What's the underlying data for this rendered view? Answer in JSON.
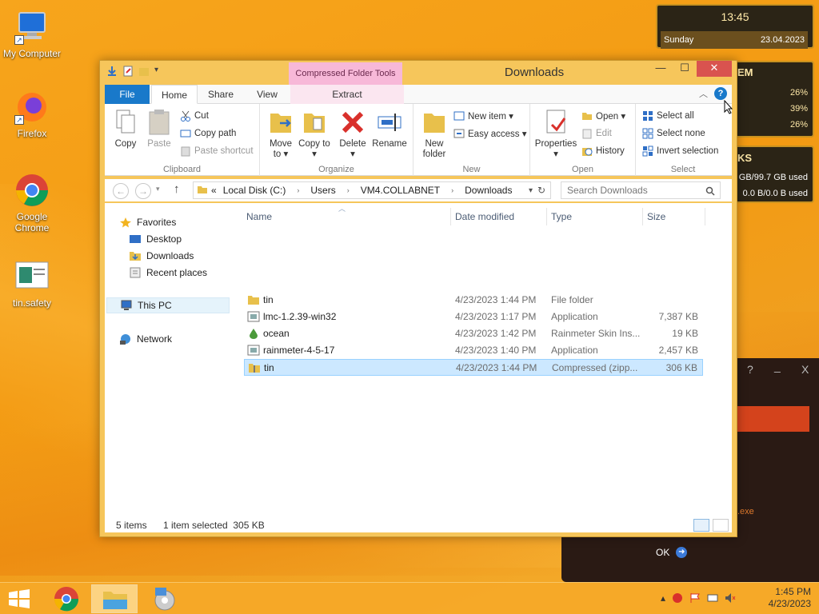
{
  "desktop": {
    "icons": [
      {
        "label": "My Computer"
      },
      {
        "label": "Firefox"
      },
      {
        "label": "Google Chrome"
      },
      {
        "label": "tin.safety"
      }
    ]
  },
  "widgets": {
    "clock": {
      "time": "13:45",
      "day": "Sunday",
      "date": "23.04.2023"
    },
    "system": {
      "title": "EM",
      "cpu1": "26%",
      "cpu2": "39%",
      "cpu3": "26%"
    },
    "disks": {
      "title": "KS",
      "line1": "GB/99.7 GB used",
      "line2": "0.0 B/0.0 B used"
    }
  },
  "explorer": {
    "title": "Downloads",
    "context_tab_group": "Compressed Folder Tools",
    "window_buttons": {
      "minimize": "—",
      "maximize": "☐",
      "close": "✕"
    },
    "tabs": {
      "file": "File",
      "home": "Home",
      "share": "Share",
      "view": "View",
      "extract": "Extract"
    },
    "help": "?",
    "ribbon": {
      "clipboard": {
        "label": "Clipboard",
        "copy": "Copy",
        "paste": "Paste",
        "cut": "Cut",
        "copy_path": "Copy path",
        "paste_shortcut": "Paste shortcut"
      },
      "organize": {
        "label": "Organize",
        "move_to": "Move to ▾",
        "copy_to": "Copy to ▾",
        "delete": "Delete ▾",
        "rename": "Rename"
      },
      "new": {
        "label": "New",
        "new_folder": "New folder",
        "new_item": "New item ▾",
        "easy_access": "Easy access ▾"
      },
      "open": {
        "label": "Open",
        "properties": "Properties ▾",
        "open": "Open ▾",
        "edit": "Edit",
        "history": "History"
      },
      "select": {
        "label": "Select",
        "select_all": "Select all",
        "select_none": "Select none",
        "invert_selection": "Invert selection"
      }
    },
    "address": {
      "prefix": "«",
      "crumbs": [
        "Local Disk (C:)",
        "Users",
        "VM4.COLLABNET",
        "Downloads"
      ],
      "search_placeholder": "Search Downloads"
    },
    "nav": {
      "favorites": "Favorites",
      "desktop": "Desktop",
      "downloads": "Downloads",
      "recent": "Recent places",
      "this_pc": "This PC",
      "network": "Network"
    },
    "columns": {
      "name": "Name",
      "date": "Date modified",
      "type": "Type",
      "size": "Size"
    },
    "files": [
      {
        "name": "tin",
        "date": "4/23/2023 1:44 PM",
        "type": "File folder",
        "size": ""
      },
      {
        "name": "lmc-1.2.39-win32",
        "date": "4/23/2023 1:17 PM",
        "type": "Application",
        "size": "7,387 KB"
      },
      {
        "name": "ocean",
        "date": "4/23/2023 1:42 PM",
        "type": "Rainmeter Skin Ins...",
        "size": "19 KB"
      },
      {
        "name": "rainmeter-4-5-17",
        "date": "4/23/2023 1:40 PM",
        "type": "Application",
        "size": "2,457 KB"
      },
      {
        "name": "tin",
        "date": "4/23/2023 1:44 PM",
        "type": "Compressed (zipp...",
        "size": "306 KB"
      }
    ],
    "status": {
      "count": "5 items",
      "selection": "1 item selected  305 KB"
    }
  },
  "dialog": {
    "help": "?",
    "minimize": "_",
    "close": "X",
    "exe_text": ".exe",
    "ok": "OK"
  },
  "taskbar": {
    "time": "1:45 PM",
    "date": "4/23/2023"
  },
  "colors": {
    "file_tab": "#1979ca",
    "selection": "#cce8ff",
    "close_button": "#d9534f"
  }
}
